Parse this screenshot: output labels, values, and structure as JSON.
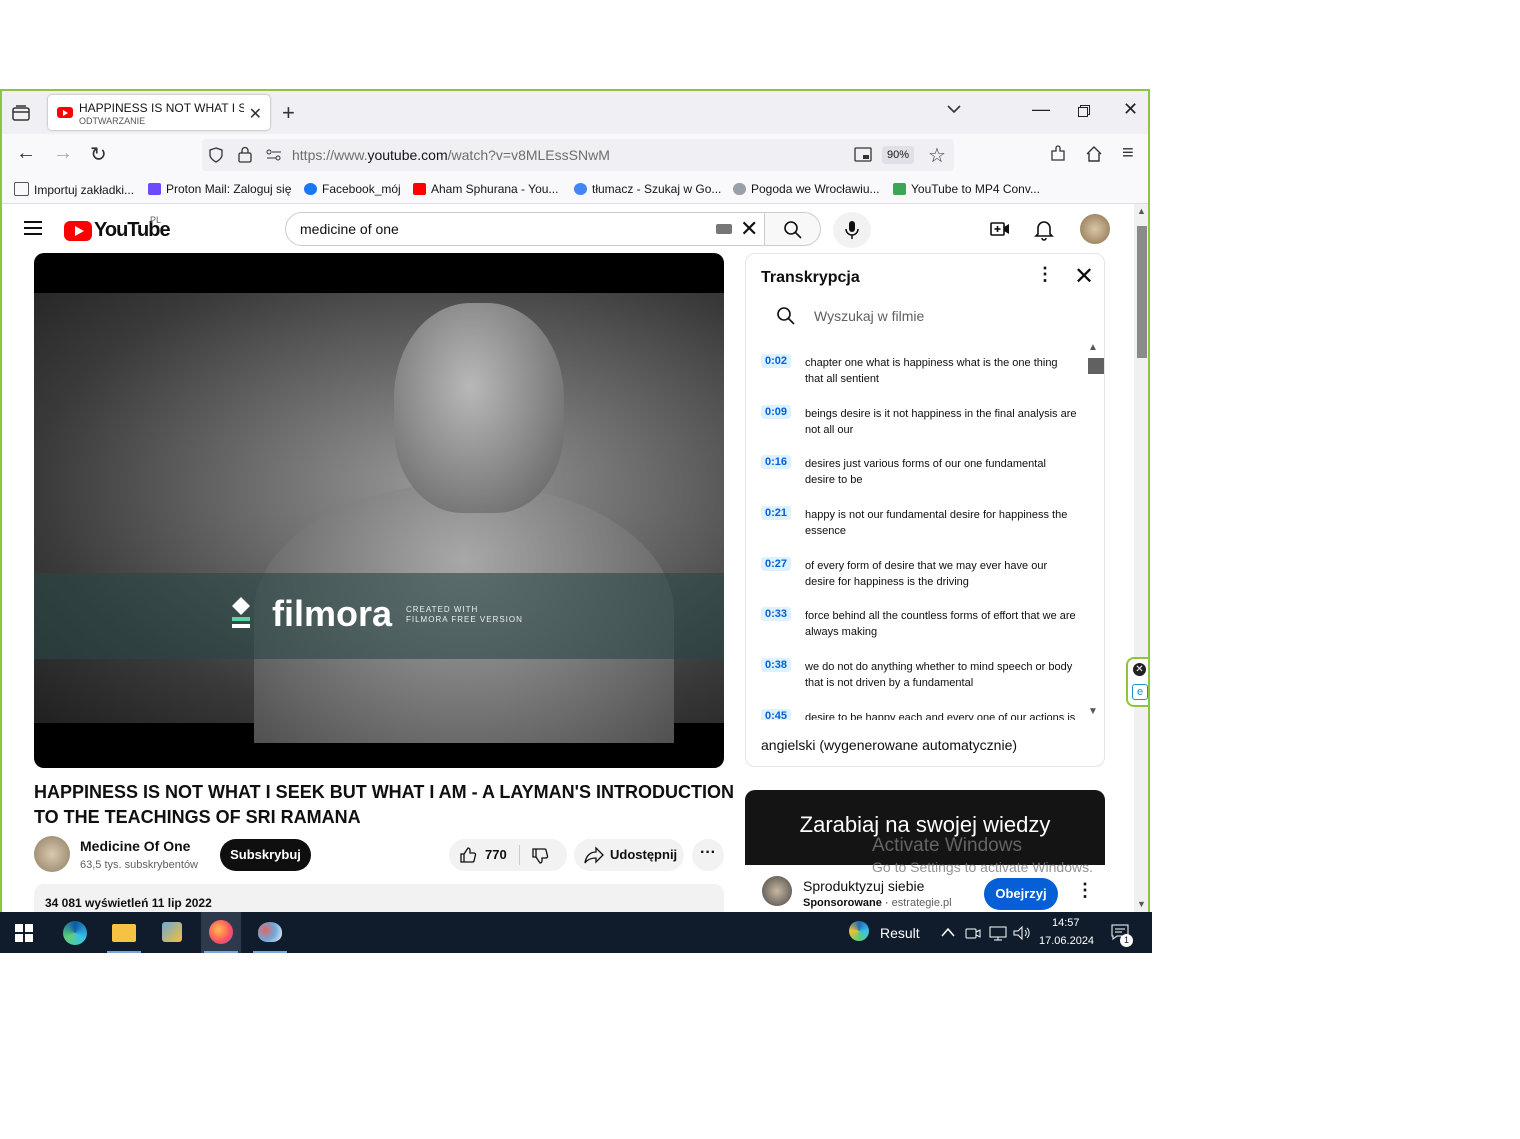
{
  "browser": {
    "tab_title": "HAPPINESS IS NOT WHAT I SEEK",
    "tab_subtitle": "ODTWARZANIE",
    "url_prefix": "https://www.",
    "url_domain": "youtube.com",
    "url_path": "/watch?v=v8MLEssSNwM",
    "zoom": "90%"
  },
  "bookmarks": [
    {
      "label": "Importuj zakładki...",
      "color": "#555555"
    },
    {
      "label": "Proton Mail: Zaloguj się",
      "color": "#6d4aff"
    },
    {
      "label": "Facebook_mój",
      "color": "#1877f2"
    },
    {
      "label": "Aham Sphurana - You...",
      "color": "#ff0000"
    },
    {
      "label": "tłumacz - Szukaj w Go...",
      "color": "#4285f4"
    },
    {
      "label": "Pogoda we Wrocławiu...",
      "color": "#9aa0a6"
    },
    {
      "label": "YouTube to MP4 Conv...",
      "color": "#3aa757"
    }
  ],
  "youtube": {
    "logo_text": "YouTube",
    "country": "PL",
    "search_query": "medicine of one"
  },
  "video": {
    "watermark": "filmora",
    "watermark_sub_1": "CREATED WITH",
    "watermark_sub_2": "FILMORA FREE VERSION",
    "title": "HAPPINESS IS NOT WHAT I SEEK BUT WHAT I AM - A LAYMAN'S INTRODUCTION TO THE TEACHINGS OF SRI RAMANA",
    "channel": "Medicine Of One",
    "subscribers": "63,5 tys. subskrybentów",
    "subscribe_label": "Subskrybuj",
    "likes": "770",
    "share_label": "Udostępnij",
    "views_date": "34 081 wyświetleń  11 lip 2022"
  },
  "transcript": {
    "header": "Transkrypcja",
    "search_placeholder": "Wyszukaj w filmie",
    "language": "angielski (wygenerowane automatycznie)",
    "segments": [
      {
        "time": "0:02",
        "text": "chapter one what is happiness what is the one thing that all sentient"
      },
      {
        "time": "0:09",
        "text": "beings desire is it not happiness in the final analysis are not all our"
      },
      {
        "time": "0:16",
        "text": "desires just various forms of our one fundamental desire to be"
      },
      {
        "time": "0:21",
        "text": "happy is not our fundamental desire for happiness the essence"
      },
      {
        "time": "0:27",
        "text": "of every form of desire that we may ever have our desire for happiness is the driving"
      },
      {
        "time": "0:33",
        "text": "force behind all the countless forms of effort that we are always making"
      },
      {
        "time": "0:38",
        "text": "we do not do anything whether to mind speech or body that is not driven by a fundamental"
      },
      {
        "time": "0:45",
        "text": "desire to be happy each and every one of our actions is"
      }
    ]
  },
  "ad": {
    "banner": "Zarabiaj na swojej wiedzy",
    "title": "Sproduktyzuj siebie",
    "sponsored": "Sponsorowane",
    "domain": "estrategie.pl",
    "watch_label": "Obejrzyj"
  },
  "watermark": {
    "line1": "Activate Windows",
    "line2": "Go to Settings to activate Windows."
  },
  "taskbar": {
    "result_label": "Result",
    "time": "14:57",
    "date": "17.06.2024",
    "notif_count": "1"
  }
}
